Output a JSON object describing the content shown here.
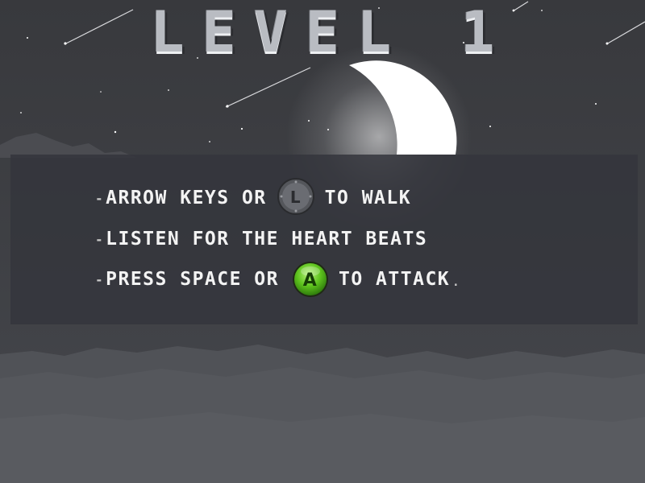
{
  "title": "LEVEL 1",
  "instructions": {
    "line1": {
      "dash": "-",
      "before": "ARROW KEYS OR",
      "icon": "analog-stick-icon",
      "icon_letter": "L",
      "after": "TO WALK"
    },
    "line2": {
      "dash": "-",
      "text": "LISTEN FOR THE HEART BEATS"
    },
    "line3": {
      "dash": "-",
      "before": "PRESS SPACE OR",
      "icon": "a-button-icon",
      "icon_letter": "A",
      "after": "TO ATTACK",
      "end": "."
    }
  },
  "colors": {
    "sky": "#3a3b3f",
    "moon": "#ffffff",
    "panel": "#34363c",
    "text": "#f3f3f3",
    "a_button": "#5fc41e"
  }
}
